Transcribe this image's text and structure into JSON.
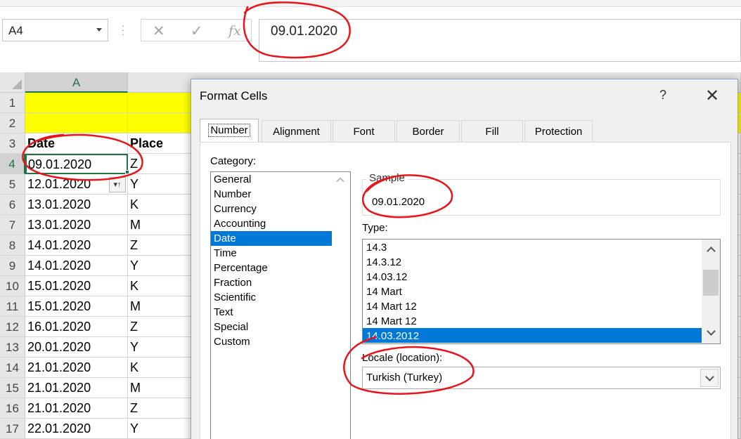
{
  "namebox": {
    "value": "A4"
  },
  "formula_bar": {
    "value": "09.01.2020"
  },
  "grid": {
    "columns": [
      "A"
    ],
    "rows": [
      {
        "num": "1",
        "a": "",
        "b": ""
      },
      {
        "num": "2",
        "a": "",
        "b": ""
      },
      {
        "num": "3",
        "a": "Date",
        "b": "Place"
      },
      {
        "num": "4",
        "a": "09.01.2020",
        "b": "Z"
      },
      {
        "num": "5",
        "a": "12.01.2020",
        "b": "Y"
      },
      {
        "num": "6",
        "a": "13.01.2020",
        "b": "K"
      },
      {
        "num": "7",
        "a": "13.01.2020",
        "b": "M"
      },
      {
        "num": "8",
        "a": "14.01.2020",
        "b": "Z"
      },
      {
        "num": "9",
        "a": "14.01.2020",
        "b": "Y"
      },
      {
        "num": "10",
        "a": "15.01.2020",
        "b": "K"
      },
      {
        "num": "11",
        "a": "15.01.2020",
        "b": "M"
      },
      {
        "num": "12",
        "a": "16.01.2020",
        "b": "Z"
      },
      {
        "num": "13",
        "a": "20.01.2020",
        "b": "Y"
      },
      {
        "num": "14",
        "a": "21.01.2020",
        "b": "K"
      },
      {
        "num": "15",
        "a": "21.01.2020",
        "b": "M"
      },
      {
        "num": "16",
        "a": "21.01.2020",
        "b": "Z"
      },
      {
        "num": "17",
        "a": "22.01.2020",
        "b": "Y"
      }
    ]
  },
  "dialog": {
    "title": "Format Cells",
    "help": "?",
    "close": "✕",
    "tabs": [
      "Number",
      "Alignment",
      "Font",
      "Border",
      "Fill",
      "Protection"
    ],
    "category_label": "Category:",
    "categories": [
      "General",
      "Number",
      "Currency",
      "Accounting",
      "Date",
      "Time",
      "Percentage",
      "Fraction",
      "Scientific",
      "Text",
      "Special",
      "Custom"
    ],
    "selected_category": "Date",
    "sample_label": "Sample",
    "sample_value": "09.01.2020",
    "type_label": "Type:",
    "types": [
      "14.3",
      "14.3.12",
      "14.03.12",
      "14 Mart",
      "14 Mart 12",
      "14 Mart 12",
      "14.03.2012"
    ],
    "selected_type": "14.03.2012",
    "locale_label": "Locale (location):",
    "locale_value": "Turkish (Turkey)"
  },
  "colors": {
    "accent": "#217346",
    "selection": "#0078d7",
    "highlight": "#ffff00",
    "annotation": "#e8141b"
  }
}
